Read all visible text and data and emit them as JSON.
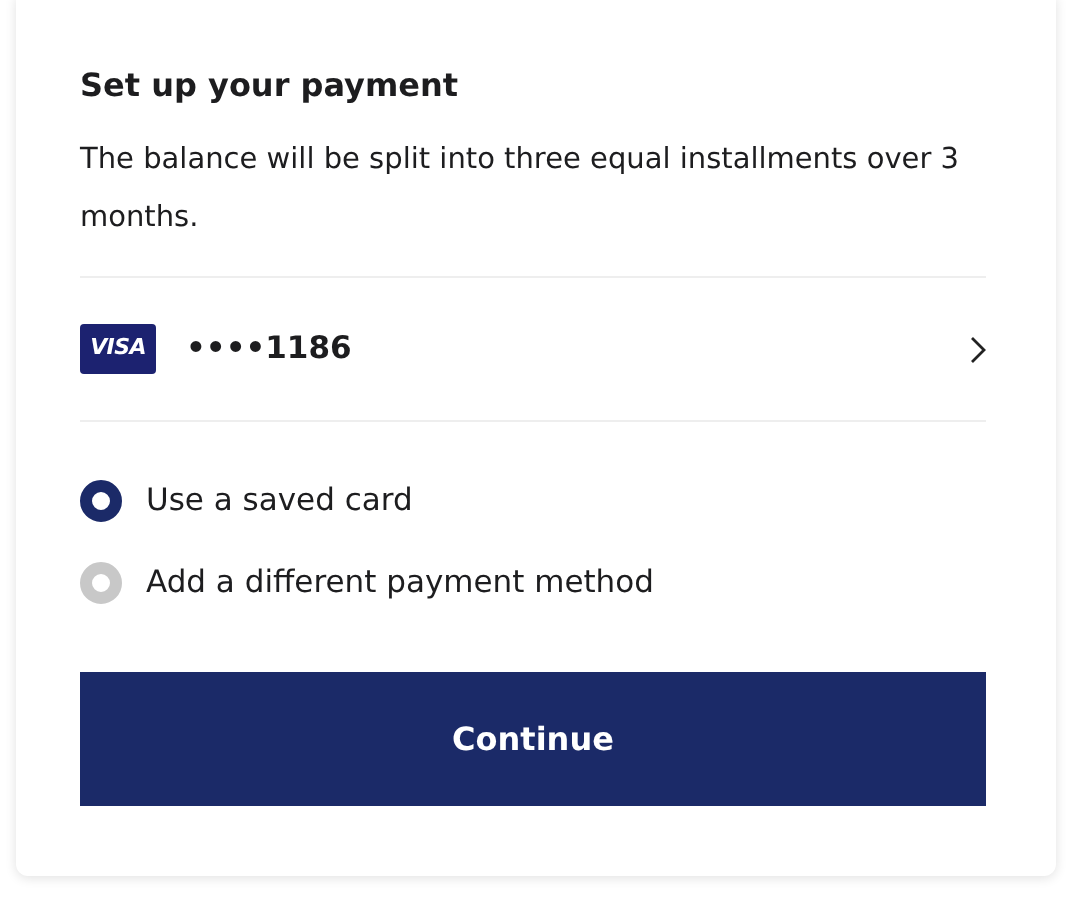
{
  "title": "Set up your payment",
  "description": "The balance will be split into three equal installments over 3 months.",
  "saved_card": {
    "brand": "VISA",
    "number": "••••1186"
  },
  "options": [
    {
      "label": "Use a saved card",
      "selected": true
    },
    {
      "label": "Add a different payment method",
      "selected": false
    }
  ],
  "button": "Continue"
}
